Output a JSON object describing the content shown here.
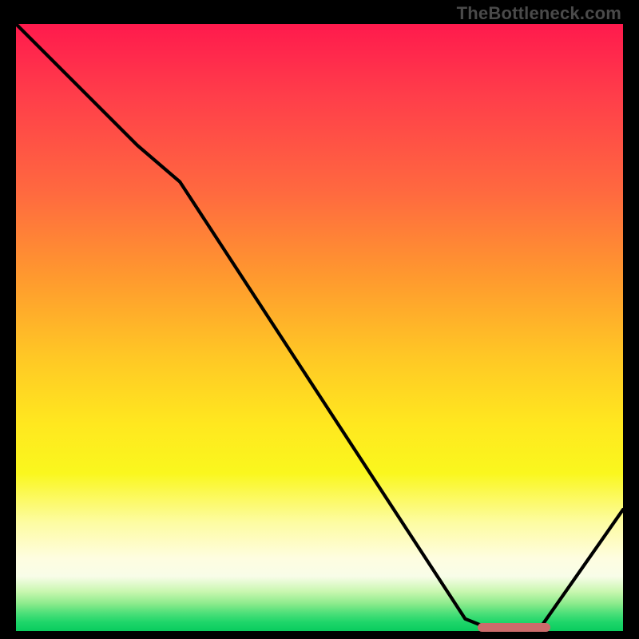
{
  "watermark": "TheBottleneck.com",
  "chart_data": {
    "type": "line",
    "title": "",
    "xlabel": "",
    "ylabel": "",
    "xlim": [
      0,
      100
    ],
    "ylim": [
      0,
      100
    ],
    "grid": false,
    "series": [
      {
        "name": "curve",
        "x": [
          0,
          20,
          27,
          74,
          79,
          86,
          100
        ],
        "values": [
          100,
          80,
          74,
          2,
          0,
          0,
          20
        ]
      }
    ],
    "marker": {
      "x_start": 76,
      "x_end": 88,
      "y": 0.6
    },
    "gradient_stops": [
      {
        "pos": 0,
        "color": "#ff1a4d"
      },
      {
        "pos": 28,
        "color": "#ff6a3f"
      },
      {
        "pos": 55,
        "color": "#ffc825"
      },
      {
        "pos": 74,
        "color": "#faf71e"
      },
      {
        "pos": 88,
        "color": "#fefde0"
      },
      {
        "pos": 95.5,
        "color": "#8ceb8c"
      },
      {
        "pos": 100,
        "color": "#0acc5e"
      }
    ]
  }
}
